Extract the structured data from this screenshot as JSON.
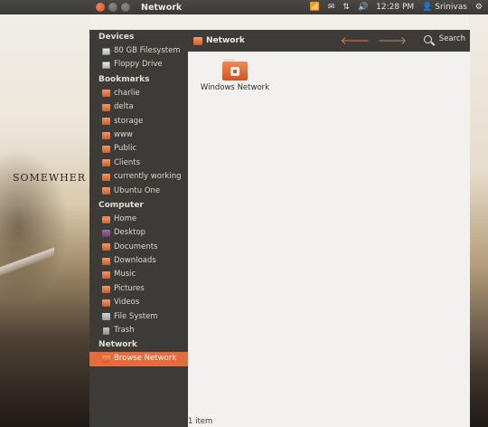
{
  "desktop": {
    "wallpaper_text": "SOMEWHER"
  },
  "top_panel": {
    "window_title": "Network",
    "clock": "12:28 PM",
    "user": "Srinivas",
    "indicator_icons": [
      "network-wireless-icon",
      "mail-icon",
      "transfer-arrows-icon",
      "volume-icon",
      "user-icon",
      "gear-icon"
    ]
  },
  "toolbar": {
    "location_label": "Network",
    "search_label": "Search"
  },
  "sidebar": {
    "sections": [
      {
        "title": "Devices",
        "items": [
          {
            "label": "80 GB Filesystem",
            "icon": "drive-icon"
          },
          {
            "label": "Floppy Drive",
            "icon": "drive-icon"
          }
        ]
      },
      {
        "title": "Bookmarks",
        "items": [
          {
            "label": "charlie",
            "icon": "folder-icon"
          },
          {
            "label": "delta",
            "icon": "folder-icon"
          },
          {
            "label": "storage",
            "icon": "folder-icon"
          },
          {
            "label": "www",
            "icon": "folder-icon"
          },
          {
            "label": "Public",
            "icon": "folder-icon"
          },
          {
            "label": "Clients",
            "icon": "folder-icon"
          },
          {
            "label": "currently working",
            "icon": "folder-icon"
          },
          {
            "label": "Ubuntu One",
            "icon": "folder-icon"
          }
        ]
      },
      {
        "title": "Computer",
        "items": [
          {
            "label": "Home",
            "icon": "home-icon"
          },
          {
            "label": "Desktop",
            "icon": "desktop-icon"
          },
          {
            "label": "Documents",
            "icon": "folder-icon"
          },
          {
            "label": "Downloads",
            "icon": "folder-icon"
          },
          {
            "label": "Music",
            "icon": "folder-icon"
          },
          {
            "label": "Pictures",
            "icon": "folder-icon"
          },
          {
            "label": "Videos",
            "icon": "folder-icon"
          },
          {
            "label": "File System",
            "icon": "filesystem-icon"
          },
          {
            "label": "Trash",
            "icon": "trash-icon"
          }
        ]
      },
      {
        "title": "Network",
        "items": [
          {
            "label": "Browse Network",
            "icon": "network-icon",
            "selected": true
          }
        ]
      }
    ]
  },
  "content": {
    "items": [
      {
        "label": "Windows Network",
        "icon": "network-folder-icon"
      }
    ],
    "status": "1 item"
  },
  "colors": {
    "accent": "#e86a3a",
    "panel": "#3c3b37",
    "content_bg": "#f2f1f0"
  }
}
